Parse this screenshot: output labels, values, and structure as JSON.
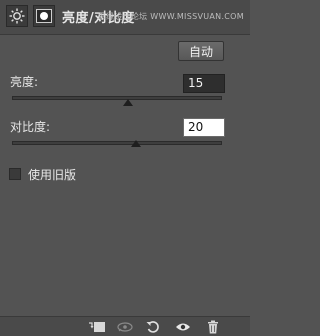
{
  "header": {
    "title": "亮度/对比度",
    "watermark": "思缘设计论坛 WWW.MISSVUAN.COM"
  },
  "auto_button": {
    "label": "自动"
  },
  "brightness": {
    "label": "亮度:",
    "value": "15",
    "slider_fraction": 0.55
  },
  "contrast": {
    "label": "对比度:",
    "value": "20",
    "slider_fraction": 0.59
  },
  "legacy": {
    "label": "使用旧版",
    "checked": false
  },
  "footer": {
    "icons": [
      "clip-to-layer-icon",
      "view-previous-icon",
      "reset-icon",
      "visibility-eye-icon",
      "trash-icon"
    ]
  },
  "colors": {
    "panel_bg": "#535353",
    "header_bg": "#4a4a4a",
    "text": "#e8e8e8"
  }
}
